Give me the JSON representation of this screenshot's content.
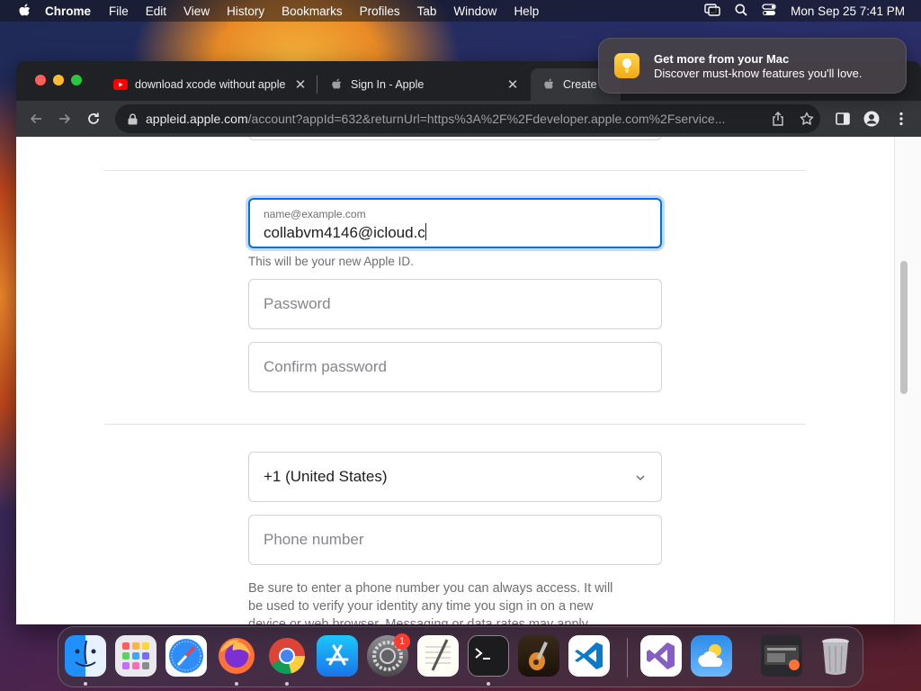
{
  "menubar": {
    "app_name": "Chrome",
    "items": [
      "File",
      "Edit",
      "View",
      "History",
      "Bookmarks",
      "Profiles",
      "Tab",
      "Window",
      "Help"
    ],
    "clock": "Mon Sep 25  7:41 PM"
  },
  "notification": {
    "title": "Get more from your Mac",
    "body": "Discover must-know features you'll love."
  },
  "browser": {
    "tabs": [
      {
        "title": "download xcode without apple",
        "icon": "youtube-icon"
      },
      {
        "title": "Sign In - Apple",
        "icon": "apple-icon"
      },
      {
        "title": "Create",
        "icon": "apple-icon"
      }
    ],
    "url_host": "appleid.apple.com",
    "url_path": "/account?appId=632&returnUrl=https%3A%2F%2Fdeveloper.apple.com%2Fservice..."
  },
  "form": {
    "email": {
      "label": "name@example.com",
      "value": "collabvm4146@icloud.c",
      "hint": "This will be your new Apple ID."
    },
    "password_placeholder": "Password",
    "confirm_placeholder": "Confirm password",
    "country_code": "+1 (United States)",
    "phone_placeholder": "Phone number",
    "disclaimer": "Be sure to enter a phone number you can always access. It will be used to verify your identity any time you sign in on a new device or web browser. Messaging or data rates may apply."
  },
  "dock": {
    "apps": [
      "finder-icon",
      "launchpad-icon",
      "safari-icon",
      "firefox-icon",
      "chrome-icon",
      "app-store-icon",
      "system-settings-icon",
      "textedit-icon",
      "terminal-icon",
      "garageband-icon",
      "vscode-icon",
      "visual-studio-icon",
      "weather-icon",
      "screen-recording-icon",
      "trash-icon"
    ],
    "settings_badge": "1"
  },
  "colors": {
    "accent": "#0071e3",
    "menubar_text": "#ffffff",
    "chrome_dark": "#202124"
  }
}
